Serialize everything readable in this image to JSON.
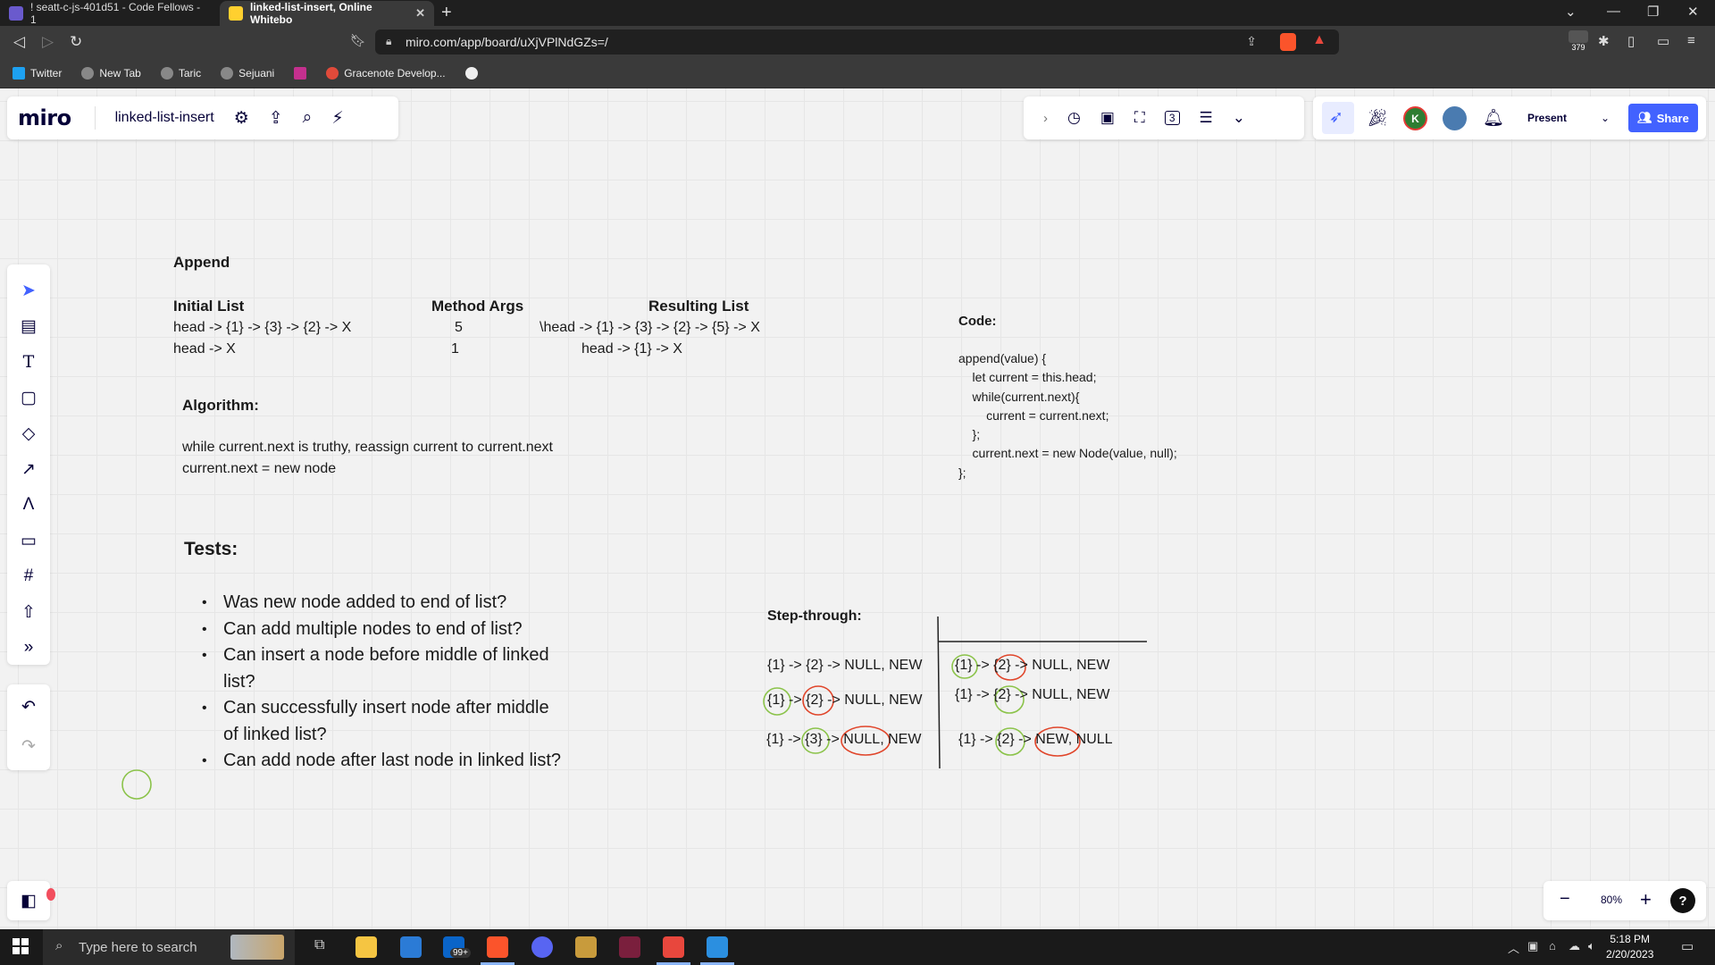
{
  "browser": {
    "tabs": [
      {
        "title": "! seatt-c-js-401d51 - Code Fellows - 1",
        "active": false
      },
      {
        "title": "linked-list-insert, Online Whitebo",
        "active": true
      }
    ],
    "url": "miro.com/app/board/uXjVPlNdGZs=/",
    "bookmarks": [
      "Twitter",
      "New Tab",
      "Taric",
      "Sejuani",
      "Gracenote Develop..."
    ],
    "extension_badge": "379"
  },
  "miro": {
    "logo": "miro",
    "board_title": "linked-list-insert",
    "avatar_letter": "K",
    "present_label": "Present",
    "share_label": "Share",
    "zoom": "80%",
    "counter_icon_label": "3"
  },
  "board": {
    "append_title": "Append",
    "table": {
      "headers": [
        "Initial List",
        "Method Args",
        "Resulting List"
      ],
      "rows": [
        [
          "head -> {1} -> {3} -> {2} -> X",
          "5",
          "\\head -> {1} -> {3} -> {2} -> {5} -> X"
        ],
        [
          "head -> X",
          "1",
          "head -> {1} -> X"
        ]
      ]
    },
    "algorithm_title": "Algorithm:",
    "algorithm_lines": [
      "while current.next is truthy, reassign current to current.next",
      "current.next = new node"
    ],
    "tests_title": "Tests:",
    "tests": [
      "Was new node added to end of list?",
      "Can add multiple nodes to end of list?",
      "Can insert a node before middle of linked list?",
      "Can successfully insert node after middle of linked list?",
      "Can add node after last node in linked list?"
    ],
    "code_title": "Code:",
    "code_lines": [
      "append(value) {",
      "    let current = this.head;",
      "    while(current.next){",
      "        current = current.next;",
      "    };",
      "    current.next = new Node(value, null);",
      "};"
    ],
    "step_title": "Step-through:",
    "step_cells": [
      "{1} -> {2} -> NULL, NEW",
      "{1} -> {2} -> NULL, NEW",
      "{1} -> {2} -> NULL, NEW",
      "{1} -> {2} -> NULL, NEW",
      "{1} -> {3} -> NULL, NEW",
      "{1} -> {2} -> NEW, NULL"
    ],
    "colors": {
      "green_circle": "#8bc34a",
      "red_circle": "#e0452a"
    }
  },
  "taskbar": {
    "search_placeholder": "Type here to search",
    "time": "5:18 PM",
    "date": "2/20/2023",
    "mail_badge": "99+"
  }
}
